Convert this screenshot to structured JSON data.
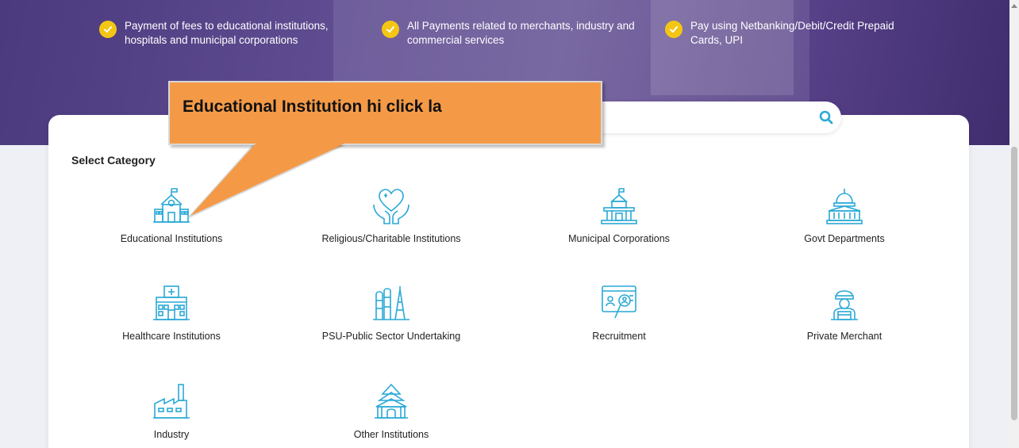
{
  "hero": {
    "features": [
      {
        "text": "Payment of fees to educational institutions, hospitals and municipal corporations"
      },
      {
        "text": "All Payments related to merchants, industry and commercial services"
      },
      {
        "text": "Pay using Netbanking/Debit/Credit Prepaid Cards, UPI"
      }
    ],
    "check_color": "#f3c614"
  },
  "search": {
    "icon": "search-icon",
    "accent": "#29a9d6"
  },
  "section": {
    "title": "Select Category"
  },
  "categories": [
    {
      "label": "Educational Institutions",
      "icon": "school-icon"
    },
    {
      "label": "Religious/Charitable Institutions",
      "icon": "heart-hands-icon"
    },
    {
      "label": "Municipal Corporations",
      "icon": "municipal-building-icon"
    },
    {
      "label": "Govt Departments",
      "icon": "capitol-icon"
    },
    {
      "label": "Healthcare Institutions",
      "icon": "hospital-icon"
    },
    {
      "label": "PSU-Public Sector Undertaking",
      "icon": "oil-refinery-icon"
    },
    {
      "label": "Recruitment",
      "icon": "recruitment-icon"
    },
    {
      "label": "Private Merchant",
      "icon": "merchant-icon"
    },
    {
      "label": "Industry",
      "icon": "factory-icon"
    },
    {
      "label": "Other Institutions",
      "icon": "temple-icon"
    }
  ],
  "callout": {
    "text": "Educational Institution hi click la",
    "color": "#f49a47"
  }
}
